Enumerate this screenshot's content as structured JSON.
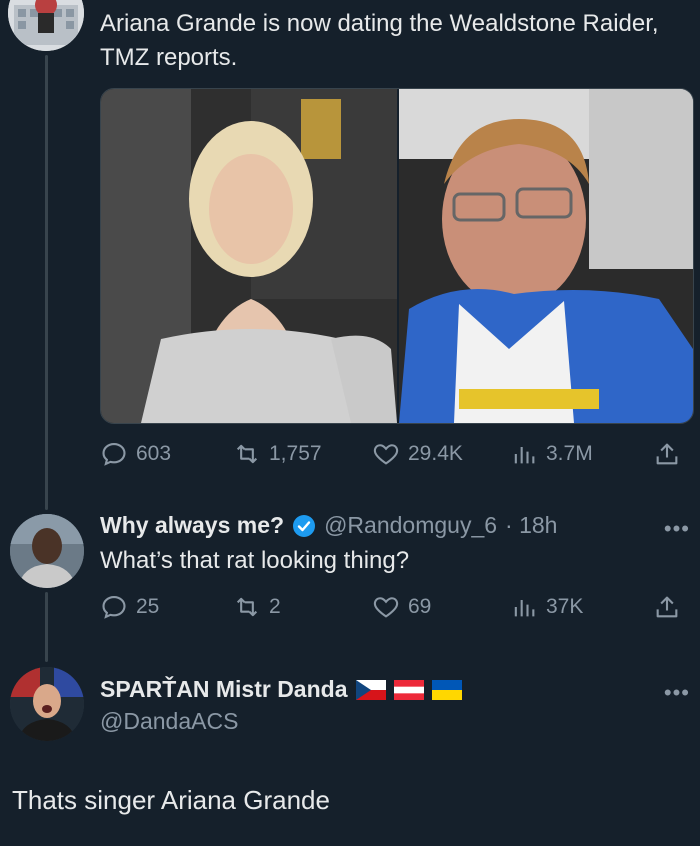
{
  "tweet1": {
    "text": "Ariana Grande is now dating the Wealdstone Raider, TMZ reports.",
    "stats": {
      "replies": "603",
      "retweets": "1,757",
      "likes": "29.4K",
      "views": "3.7M"
    }
  },
  "reply1": {
    "display_name": "Why always me?",
    "handle": "@Randomguy_6",
    "time": "· 18h",
    "text": "What’s that rat looking thing?",
    "stats": {
      "replies": "25",
      "retweets": "2",
      "likes": "69",
      "views": "37K"
    },
    "more": "•••"
  },
  "reply2": {
    "display_name": "SPARŤAN Mistr Danda",
    "handle": "@DandaACS",
    "text": "Thats singer Ariana Grande",
    "more": "•••",
    "flags": [
      "cz-flag-icon",
      "at-flag-icon",
      "ua-flag-icon"
    ]
  },
  "colors": {
    "background": "#15202b",
    "text": "#e7e9ea",
    "muted": "#8b98a5",
    "verified": "#1d9bf0"
  }
}
